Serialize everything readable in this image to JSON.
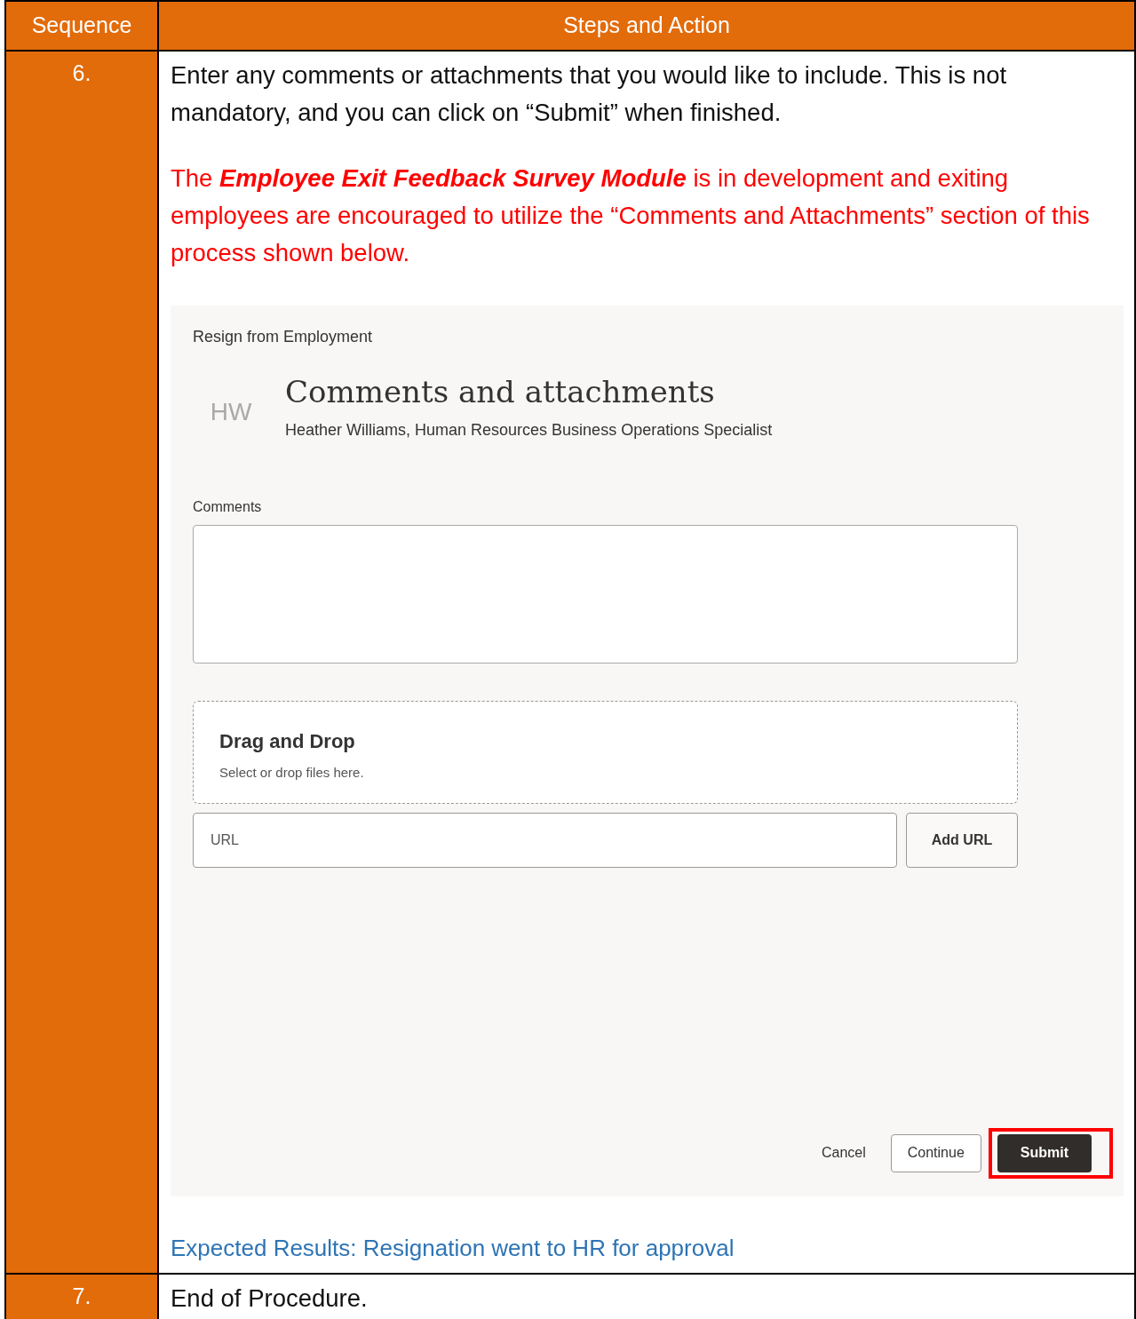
{
  "table": {
    "columns": [
      "Sequence",
      "Steps and Action"
    ],
    "rows": [
      {
        "sequence": "6.",
        "blocks": [
          {
            "kind": "text",
            "text": "Enter any comments or attachments that you would like to include. This is not mandatory, and you can click on “Submit” when finished."
          },
          {
            "kind": "warning",
            "text": "The **Employee Exit Feedback Survey Module** is in development and exiting employees are encouraged to utilize the “Comments and Attachments” section of this process shown below."
          },
          {
            "kind": "screenshot",
            "breadcrumb": "Resign from Employment",
            "avatar_initials": "HW",
            "title": "Comments and attachments",
            "subtitle": "Heather Williams, Human Resources Business Operations Specialist",
            "comments_label": "Comments",
            "dropzone": {
              "title": "Drag and Drop",
              "hint": "Select or drop files here."
            },
            "url_field": {
              "placeholder": "URL"
            },
            "add_url_button": "Add URL",
            "actions": [
              {
                "label": "Cancel",
                "kind": "link",
                "highlighted": false
              },
              {
                "label": "Continue",
                "kind": "outline",
                "highlighted": false
              },
              {
                "label": "Submit",
                "kind": "primary",
                "highlighted": true
              }
            ]
          },
          {
            "kind": "result",
            "text": "Expected Results: Resignation went to HR for approval"
          }
        ]
      },
      {
        "sequence": "7.",
        "blocks": [
          {
            "kind": "text",
            "text": "End of Procedure."
          }
        ]
      }
    ]
  }
}
